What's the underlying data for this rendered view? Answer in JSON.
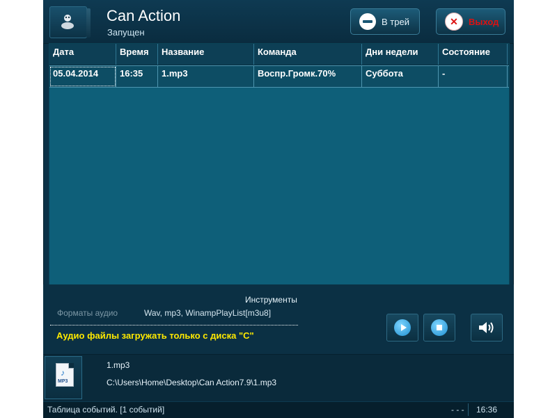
{
  "app": {
    "title": "Can Action",
    "status": "Запущен",
    "icon": "app-figure-icon"
  },
  "buttons": {
    "tray": {
      "label": "В трей",
      "icon": "minus-circle-icon"
    },
    "exit": {
      "label": "Выход",
      "icon": "close-circle-icon"
    }
  },
  "table": {
    "columns": [
      "Дата",
      "Время",
      "Название",
      "Команда",
      "Дни недели",
      "Состояние"
    ],
    "rows": [
      {
        "date": "05.04.2014",
        "time": "16:35",
        "name": "1.mp3",
        "command": "Воспр.Громк.70%",
        "days": "Суббота",
        "state": "-"
      }
    ]
  },
  "tools": {
    "title": "Инструменты",
    "formats_label": "Форматы аудио",
    "formats_value": "Wav, mp3, WinampPlayList[m3u8]",
    "note": "Аудио файлы загружать только с диска \"C\"",
    "controls": {
      "play_icon": "play-icon",
      "stop_icon": "stop-icon",
      "volume_icon": "volume-icon"
    }
  },
  "file": {
    "icon_ext": "MP3",
    "name": "1.mp3",
    "path": "C:\\Users\\Home\\Desktop\\Can Action7.9\\1.mp3"
  },
  "statusbar": {
    "left": "Таблица событий. [1 событий]",
    "dots": "- - -",
    "time": "16:36"
  },
  "colors": {
    "window_bg": "#0b3247",
    "table_bg": "#0e5f79",
    "note_yellow": "#ffe900",
    "exit_red": "#dd1111"
  }
}
